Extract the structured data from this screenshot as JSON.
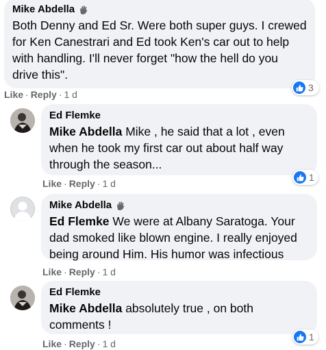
{
  "comments": [
    {
      "author": "Mike Abdella",
      "mention": "",
      "text": "Both Denny and Ed Sr. Were both super guys. I crewed for Ken Canestrari and Ed took Ken's car out to help with handling. I'll never forget \"how the hell do you drive this\".",
      "like_label": "Like",
      "reply_label": "Reply",
      "time": "1 d",
      "reaction_count": "3"
    },
    {
      "author": "Ed Flemke",
      "mention": "Mike Abdella",
      "text": " Mike , he said that a lot , even when he took my first car out about half way through the season...",
      "like_label": "Like",
      "reply_label": "Reply",
      "time": "1 d",
      "reaction_count": "1"
    },
    {
      "author": "Mike Abdella",
      "mention": "Ed Flemke",
      "text": " We were at Albany Saratoga. Your dad smoked like blown engine. I really enjoyed being around Him. His humor was infectious",
      "like_label": "Like",
      "reply_label": "Reply",
      "time": "1 d",
      "reaction_count": ""
    },
    {
      "author": "Ed Flemke",
      "mention": "Mike Abdella",
      "text": " absolutely true , on both comments !",
      "like_label": "Like",
      "reply_label": "Reply",
      "time": "1 d",
      "reaction_count": "1"
    }
  ],
  "icons": {
    "fan_badge": "top-fan-badge-icon",
    "reaction": "like-reaction-icon"
  },
  "colors": {
    "bubble": "#f0f2f5",
    "like_blue": "#1877f2",
    "meta_text": "#65676b"
  }
}
